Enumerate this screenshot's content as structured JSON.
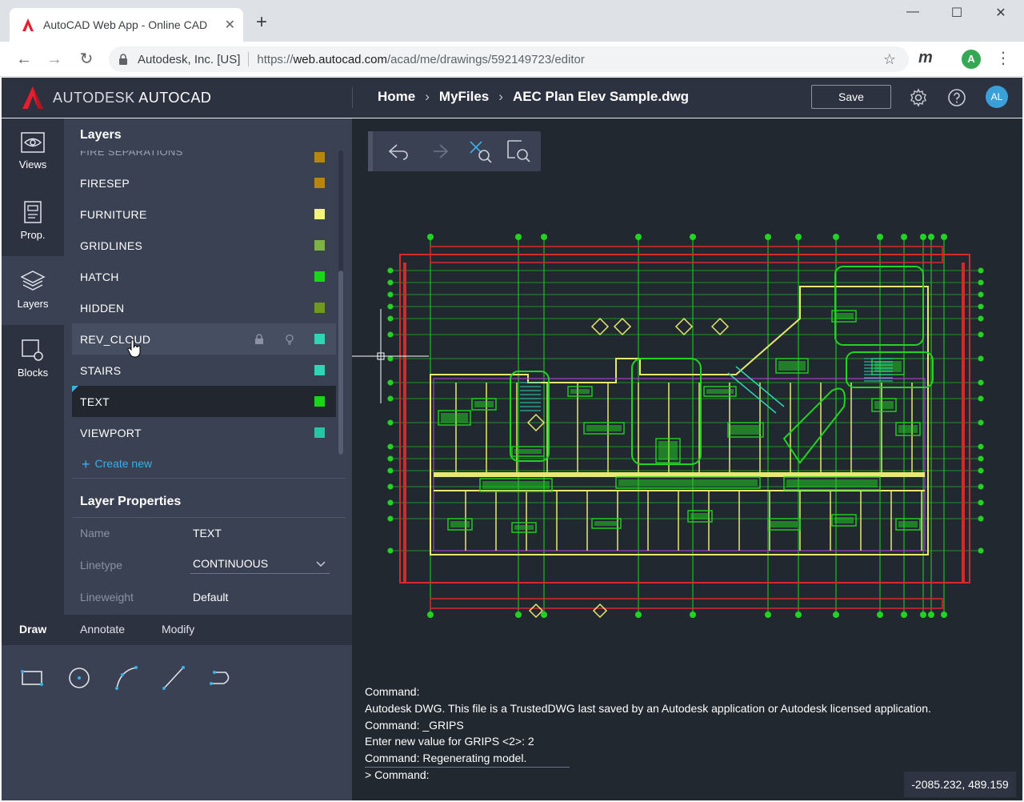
{
  "browser": {
    "tab_title": "AutoCAD Web App - Online CAD",
    "site_identity": "Autodesk, Inc. [US]",
    "url_scheme": "https://",
    "url_host": "web.autocad.com",
    "url_path": "/acad/me/drawings/592149723/editor",
    "profile_initial": "A",
    "extension_label": "m"
  },
  "app": {
    "brand_main": "AUTODESK",
    "brand_product": "AUTOCAD",
    "breadcrumb": [
      "Home",
      "MyFiles",
      "AEC Plan Elev Sample.dwg"
    ],
    "save_label": "Save",
    "user_initials": "AL"
  },
  "rail": [
    {
      "label": "Views",
      "icon": "eye-icon"
    },
    {
      "label": "Prop.",
      "icon": "properties-icon"
    },
    {
      "label": "Layers",
      "icon": "layers-icon"
    },
    {
      "label": "Blocks",
      "icon": "blocks-icon"
    }
  ],
  "layers_panel": {
    "title": "Layers",
    "partial_top_row": "FIRE SEPARATIONS",
    "layers": [
      {
        "name": "FIRESEP",
        "color": "#b8860b"
      },
      {
        "name": "FURNITURE",
        "color": "#f3f37a"
      },
      {
        "name": "GRIDLINES",
        "color": "#7cb342"
      },
      {
        "name": "HATCH",
        "color": "#19d619"
      },
      {
        "name": "HIDDEN",
        "color": "#6e9b1f"
      },
      {
        "name": "REV_CLOUD",
        "color": "#2fd5b4"
      },
      {
        "name": "STAIRS",
        "color": "#2fd5b4"
      },
      {
        "name": "TEXT",
        "color": "#19d619"
      },
      {
        "name": "VIEWPORT",
        "color": "#26c6a5"
      }
    ],
    "create_new_label": "Create new"
  },
  "layer_properties": {
    "title": "Layer Properties",
    "name_label": "Name",
    "name_value": "TEXT",
    "linetype_label": "Linetype",
    "linetype_value": "CONTINUOUS",
    "lineweight_label": "Lineweight",
    "lineweight_value": "Default"
  },
  "tool_tabs": [
    "Draw",
    "Annotate",
    "Modify"
  ],
  "command_log": [
    "Command:",
    "Autodesk DWG.  This file is a TrustedDWG last saved by an Autodesk application or Autodesk licensed application.",
    "Command: _GRIPS",
    "Enter new value for GRIPS <2>: 2",
    "Command: Regenerating model.",
    "> Command:"
  ],
  "coordinates": "-2085.232, 489.159"
}
